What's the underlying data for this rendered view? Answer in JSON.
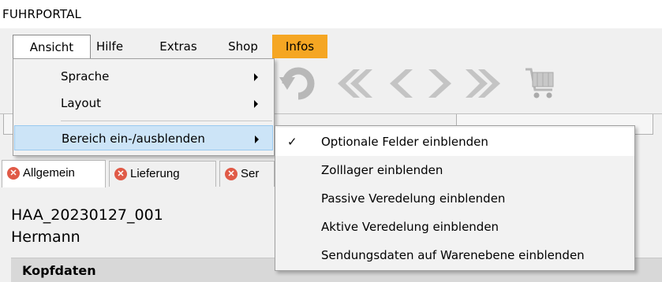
{
  "app": {
    "title": "FUHRPORTAL"
  },
  "menubar": {
    "items": [
      {
        "label": "Ansicht"
      },
      {
        "label": "Hilfe"
      },
      {
        "label": "Extras"
      },
      {
        "label": "Shop"
      },
      {
        "label": "Infos"
      }
    ],
    "infos_color": "#f5a623"
  },
  "toolbar": {
    "icons": [
      "undo-icon",
      "first-page-icon",
      "previous-icon",
      "next-icon",
      "last-page-icon",
      "shopping-cart-icon"
    ]
  },
  "dropdown": {
    "items": [
      {
        "label": "Sprache"
      },
      {
        "label": "Layout"
      },
      {
        "label": "Bereich ein-/ausblenden"
      }
    ]
  },
  "submenu": {
    "items": [
      {
        "label": "Optionale Felder einblenden",
        "checked": true
      },
      {
        "label": "Zolllager einblenden",
        "checked": false
      },
      {
        "label": "Passive Veredelung einblenden",
        "checked": false
      },
      {
        "label": "Aktive Veredelung einblenden",
        "checked": false
      },
      {
        "label": "Sendungsdaten auf Warenebene einblenden",
        "checked": false
      }
    ],
    "check_glyph": "✓"
  },
  "tabs": [
    {
      "label": "Allgemein"
    },
    {
      "label": "Lieferung"
    },
    {
      "label": "Ser"
    }
  ],
  "record": {
    "reference": "HAA_20230127_001",
    "name": "Hermann"
  },
  "section": {
    "label": "Kopfdaten"
  }
}
